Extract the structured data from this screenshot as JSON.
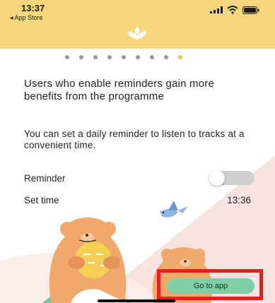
{
  "status_bar": {
    "time": "13:37",
    "back_label": "◂ App Store"
  },
  "pager": {
    "count": 9,
    "active_index": 8
  },
  "headline": "Users who enable reminders gain more benefits from the programme",
  "body": "You can set a daily reminder to listen to tracks at a convenient time.",
  "reminder": {
    "label": "Reminder",
    "enabled": false
  },
  "set_time": {
    "label": "Set time",
    "value": "13:36"
  },
  "cta": {
    "label": "Go to app"
  },
  "colors": {
    "header": "#f6d77e",
    "accent_dot": "#f2c14e",
    "cta": "#7ecfa6",
    "highlight": "#ee1d1d"
  }
}
